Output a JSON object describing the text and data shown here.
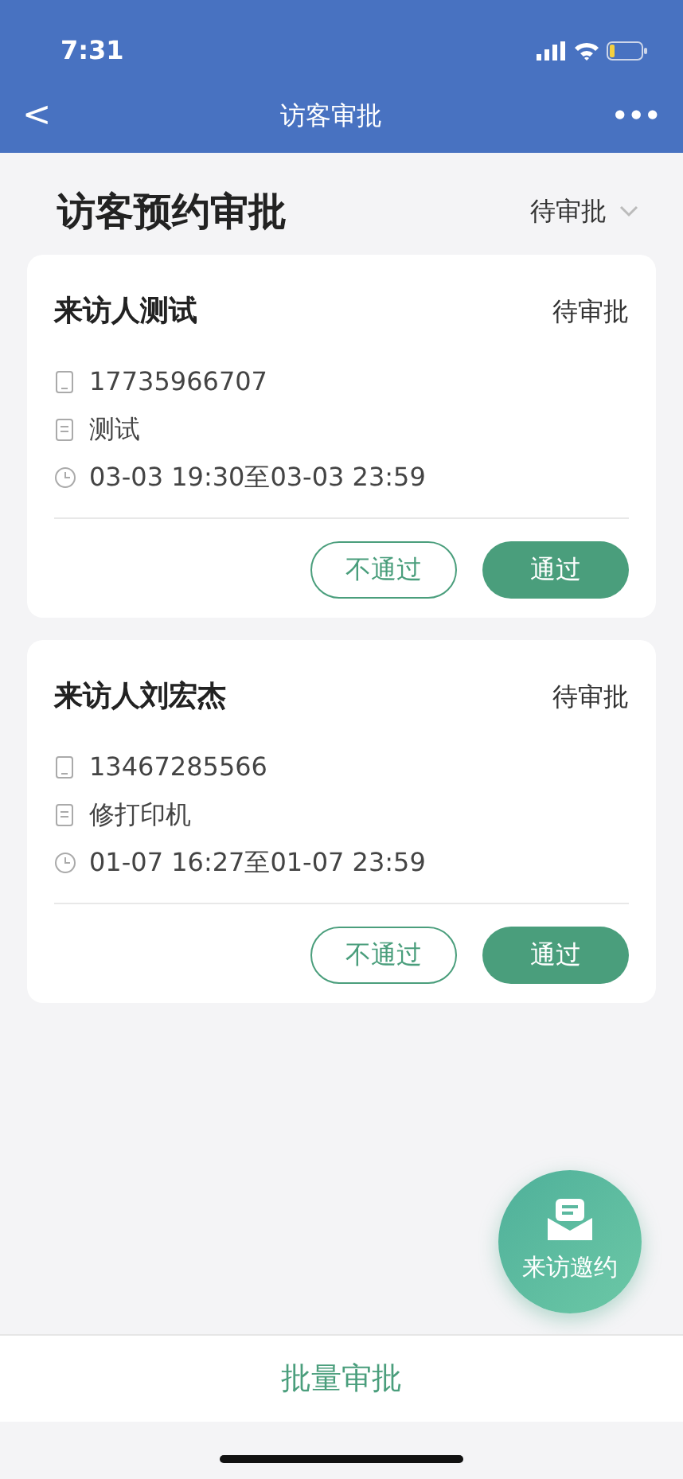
{
  "status_bar": {
    "time": "7:31"
  },
  "nav": {
    "back": "<",
    "title": "访客审批",
    "more": "•••"
  },
  "header": {
    "title": "访客预约审批",
    "filter": "待审批"
  },
  "cards": [
    {
      "name": "来访人测试",
      "status": "待审批",
      "phone": "17735966707",
      "note": "测试",
      "time": "03-03 19:30至03-03 23:59",
      "reject": "不通过",
      "approve": "通过"
    },
    {
      "name": "来访人刘宏杰",
      "status": "待审批",
      "phone": "13467285566",
      "note": "修打印机",
      "time": "01-07 16:27至01-07 23:59",
      "reject": "不通过",
      "approve": "通过"
    }
  ],
  "fab": {
    "label": "来访邀约"
  },
  "bottom_button": "批量审批"
}
